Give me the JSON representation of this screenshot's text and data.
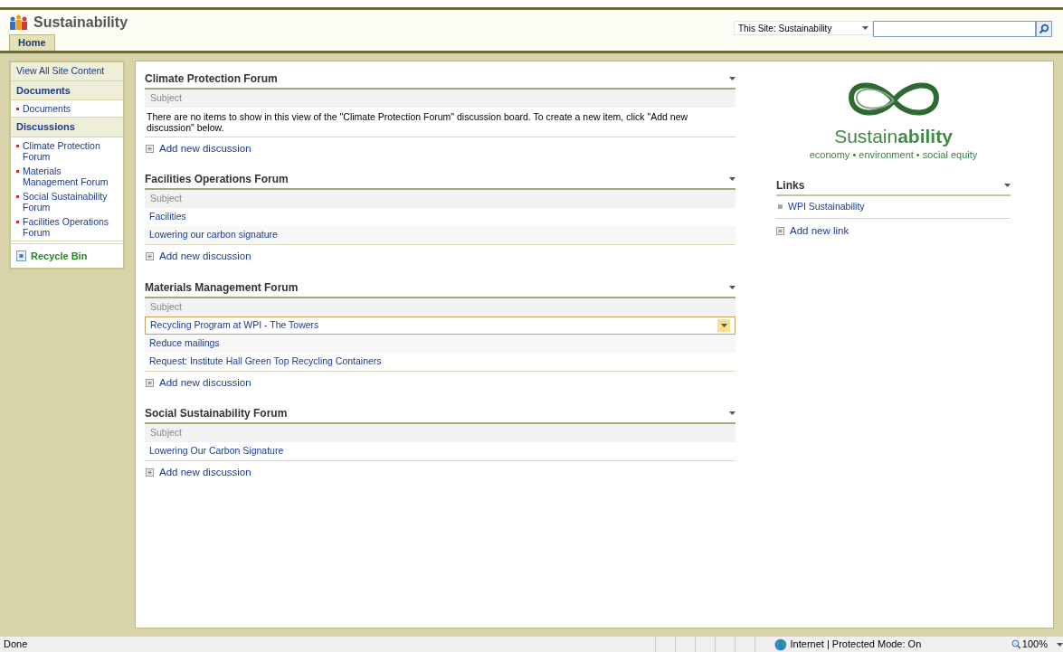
{
  "site": {
    "title": "Sustainability"
  },
  "top_tabs": [
    {
      "label": "Home",
      "selected": true
    }
  ],
  "search": {
    "scope": "This Site: Sustainability"
  },
  "quick_launch": {
    "view_all": "View All Site Content",
    "sections": [
      {
        "heading": "Documents",
        "items": [
          "Documents"
        ]
      },
      {
        "heading": "Discussions",
        "items": [
          "Climate Protection Forum",
          "Materials Management Forum",
          "Social Sustainability Forum",
          "Facilities Operations Forum"
        ]
      }
    ],
    "recycle_bin": "Recycle Bin"
  },
  "forums": [
    {
      "title": "Climate Protection Forum",
      "column": "Subject",
      "empty_message": "There are no items to show in this view of the \"Climate Protection Forum\" discussion board. To create a new item, click \"Add new discussion\" below.",
      "add_link": "Add new discussion"
    },
    {
      "title": "Facilities Operations Forum",
      "column": "Subject",
      "rows": [
        {
          "subject": "Facilities",
          "selected": false
        },
        {
          "subject": "Lowering our carbon signature",
          "selected": false
        }
      ],
      "add_link": "Add new discussion"
    },
    {
      "title": "Materials Management Forum",
      "column": "Subject",
      "rows": [
        {
          "subject": "Recycling Program at WPI - The Towers",
          "selected": true
        },
        {
          "subject": "Reduce mailings",
          "selected": false
        },
        {
          "subject": "Request: Institute Hall Green Top Recycling Containers",
          "selected": false
        }
      ],
      "add_link": "Add new discussion"
    },
    {
      "title": "Social Sustainability Forum",
      "column": "Subject",
      "rows": [
        {
          "subject": "Lowering Our Carbon Signature",
          "selected": false
        }
      ],
      "add_link": "Add new discussion"
    }
  ],
  "logo": {
    "wordmark": "Sustain**ability**",
    "tagline": "economy • environment • social equity"
  },
  "links": {
    "title": "Links",
    "items": [
      "WPI Sustainability"
    ],
    "add_link": "Add new link"
  },
  "status_bar": {
    "status": "Done",
    "zone": "Internet | Protected Mode: On",
    "zoom": "100%"
  }
}
